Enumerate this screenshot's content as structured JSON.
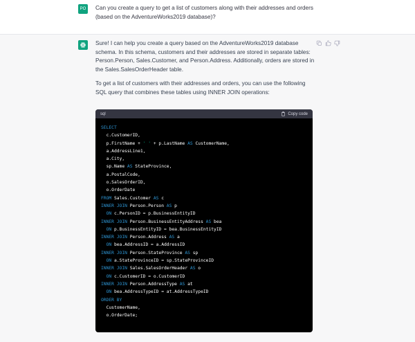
{
  "user_message": {
    "avatar": "PO",
    "text": "Can you create a query to get a list of customers along with their addresses and orders (based on the AdventureWorks2019 database)?"
  },
  "assistant_message": {
    "paragraphs": [
      "Sure! I can help you create a query based on the AdventureWorks2019 database schema. In this schema, customers and their addresses are stored in separate tables: Person.Person, Sales.Customer, and Person.Address. Additionally, orders are stored in the Sales.SalesOrderHeader table.",
      "To get a list of customers with their addresses and orders, you can use the following SQL query that combines these tables using INNER JOIN operations:"
    ],
    "actions": [
      "copy-icon",
      "thumbs-up-icon",
      "thumbs-down-icon"
    ]
  },
  "code_block": {
    "language": "sql",
    "copy_label": "Copy code",
    "lines": [
      [
        {
          "t": "SELECT",
          "k": 1
        }
      ],
      [
        {
          "t": "  c.CustomerID,"
        }
      ],
      [
        {
          "t": "  p.FirstName + "
        },
        {
          "t": "' '",
          "s": 1
        },
        {
          "t": " + p.LastName "
        },
        {
          "t": "AS",
          "k": 1
        },
        {
          "t": " CustomerName,"
        }
      ],
      [
        {
          "t": "  a.AddressLine1,"
        }
      ],
      [
        {
          "t": "  a.City,"
        }
      ],
      [
        {
          "t": "  sp.Name "
        },
        {
          "t": "AS",
          "k": 1
        },
        {
          "t": " StateProvince,"
        }
      ],
      [
        {
          "t": "  a.PostalCode,"
        }
      ],
      [
        {
          "t": "  o.SalesOrderID,"
        }
      ],
      [
        {
          "t": "  o.OrderDate"
        }
      ],
      [
        {
          "t": "FROM",
          "k": 1
        },
        {
          "t": " Sales.Customer "
        },
        {
          "t": "AS",
          "k": 1
        },
        {
          "t": " c"
        }
      ],
      [
        {
          "t": "INNER JOIN",
          "k": 1
        },
        {
          "t": " Person.Person "
        },
        {
          "t": "AS",
          "k": 1
        },
        {
          "t": " p"
        }
      ],
      [
        {
          "t": "  "
        },
        {
          "t": "ON",
          "k": 1
        },
        {
          "t": " c.PersonID = p.BusinessEntityID"
        }
      ],
      [
        {
          "t": "INNER JOIN",
          "k": 1
        },
        {
          "t": " Person.BusinessEntityAddress "
        },
        {
          "t": "AS",
          "k": 1
        },
        {
          "t": " bea"
        }
      ],
      [
        {
          "t": "  "
        },
        {
          "t": "ON",
          "k": 1
        },
        {
          "t": " p.BusinessEntityID = bea.BusinessEntityID"
        }
      ],
      [
        {
          "t": "INNER JOIN",
          "k": 1
        },
        {
          "t": " Person.Address "
        },
        {
          "t": "AS",
          "k": 1
        },
        {
          "t": " a"
        }
      ],
      [
        {
          "t": "  "
        },
        {
          "t": "ON",
          "k": 1
        },
        {
          "t": " bea.AddressID = a.AddressID"
        }
      ],
      [
        {
          "t": "INNER JOIN",
          "k": 1
        },
        {
          "t": " Person.StateProvince "
        },
        {
          "t": "AS",
          "k": 1
        },
        {
          "t": " sp"
        }
      ],
      [
        {
          "t": "  "
        },
        {
          "t": "ON",
          "k": 1
        },
        {
          "t": " a.StateProvinceID = sp.StateProvinceID"
        }
      ],
      [
        {
          "t": "INNER JOIN",
          "k": 1
        },
        {
          "t": " Sales.SalesOrderHeader "
        },
        {
          "t": "AS",
          "k": 1
        },
        {
          "t": " o"
        }
      ],
      [
        {
          "t": "  "
        },
        {
          "t": "ON",
          "k": 1
        },
        {
          "t": " c.CustomerID = o.CustomerID"
        }
      ],
      [
        {
          "t": "INNER JOIN",
          "k": 1
        },
        {
          "t": " Person.AddressType "
        },
        {
          "t": "AS",
          "k": 1
        },
        {
          "t": " at"
        }
      ],
      [
        {
          "t": "  "
        },
        {
          "t": "ON",
          "k": 1
        },
        {
          "t": " bea.AddressTypeID = at.AddressTypeID"
        }
      ],
      [
        {
          "t": "ORDER BY",
          "k": 1
        }
      ],
      [
        {
          "t": "  CustomerName,"
        }
      ],
      [
        {
          "t": "  o.OrderDate;"
        }
      ]
    ]
  },
  "colors": {
    "accent": "#10a37f",
    "keyword": "#2e95d3",
    "string": "#00a67d",
    "code_bg": "#000000",
    "code_header": "#343541"
  }
}
